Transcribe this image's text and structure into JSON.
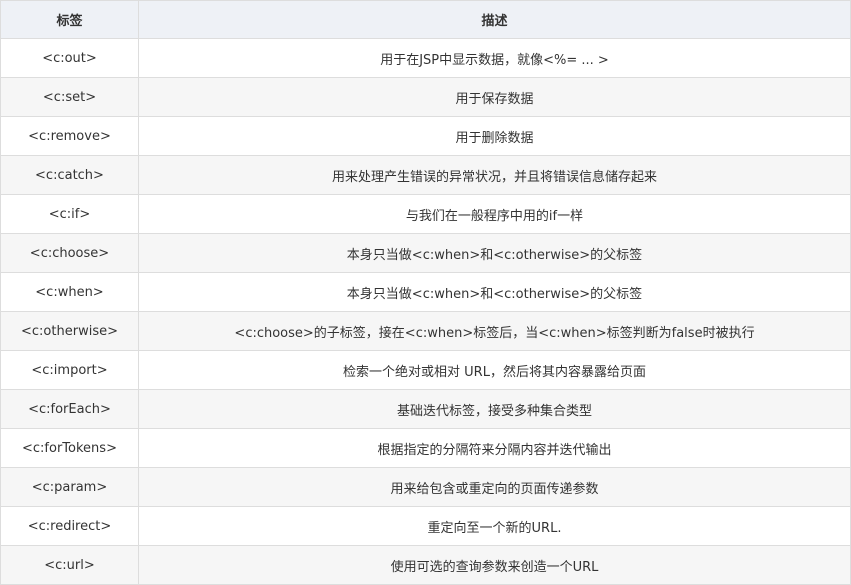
{
  "table": {
    "headers": [
      "标签",
      "描述"
    ],
    "rows": [
      {
        "tag": "<c:out>",
        "desc": "用于在JSP中显示数据，就像<%= ... >"
      },
      {
        "tag": "<c:set>",
        "desc": "用于保存数据"
      },
      {
        "tag": "<c:remove>",
        "desc": "用于删除数据"
      },
      {
        "tag": "<c:catch>",
        "desc": "用来处理产生错误的异常状况，并且将错误信息储存起来"
      },
      {
        "tag": "<c:if>",
        "desc": "与我们在一般程序中用的if一样"
      },
      {
        "tag": "<c:choose>",
        "desc": "本身只当做<c:when>和<c:otherwise>的父标签"
      },
      {
        "tag": "<c:when>",
        "desc": "本身只当做<c:when>和<c:otherwise>的父标签"
      },
      {
        "tag": "<c:otherwise>",
        "desc": "<c:choose>的子标签，接在<c:when>标签后，当<c:when>标签判断为false时被执行"
      },
      {
        "tag": "<c:import>",
        "desc": "检索一个绝对或相对 URL，然后将其内容暴露给页面"
      },
      {
        "tag": "<c:forEach>",
        "desc": "基础迭代标签，接受多种集合类型"
      },
      {
        "tag": "<c:forTokens>",
        "desc": "根据指定的分隔符来分隔内容并迭代输出"
      },
      {
        "tag": "<c:param>",
        "desc": "用来给包含或重定向的页面传递参数"
      },
      {
        "tag": "<c:redirect>",
        "desc": "重定向至一个新的URL."
      },
      {
        "tag": "<c:url>",
        "desc": "使用可选的查询参数来创造一个URL"
      }
    ]
  }
}
